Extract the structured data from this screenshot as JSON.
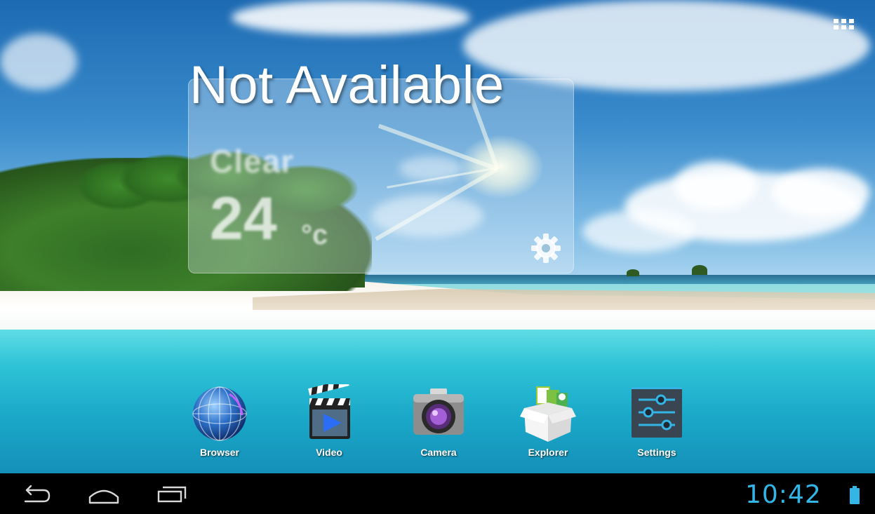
{
  "widget": {
    "headline": "Not Available",
    "condition": "Clear",
    "temperature": "24",
    "unit": "°c",
    "settings_icon": "gear-icon"
  },
  "dock": [
    {
      "label": "Browser",
      "icon": "globe-icon"
    },
    {
      "label": "Video",
      "icon": "clapperboard-icon"
    },
    {
      "label": "Camera",
      "icon": "camera-icon"
    },
    {
      "label": "Explorer",
      "icon": "box-icon"
    },
    {
      "label": "Settings",
      "icon": "sliders-icon"
    }
  ],
  "status_bar": {
    "time": "10:42",
    "battery_icon": "battery-icon",
    "accent_color": "#33b5e5"
  },
  "nav": {
    "back_icon": "back-arrow-icon",
    "home_icon": "home-icon",
    "recents_icon": "recent-apps-icon"
  },
  "all_apps_icon": "app-grid-icon"
}
